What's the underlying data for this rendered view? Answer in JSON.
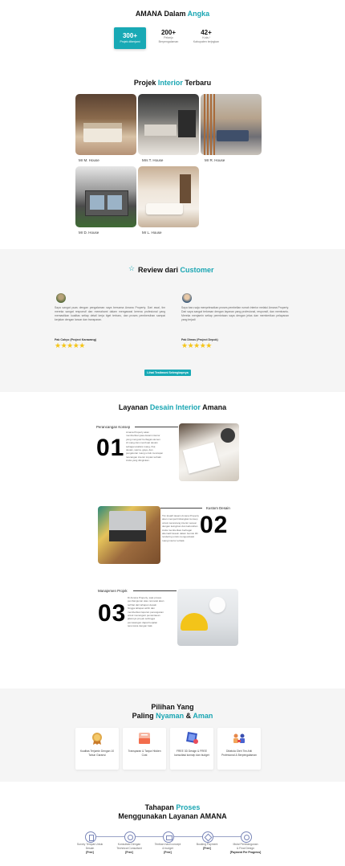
{
  "stats": {
    "title_prefix": "AMANA Dalam ",
    "title_accent": "Angka",
    "items": [
      {
        "num": "300+",
        "label": "Projek diberjami"
      },
      {
        "num": "200+",
        "label1": "Pelanjo",
        "label2": "Berpengalaman"
      },
      {
        "num": "42+",
        "label1": "Kota /",
        "label2": "Kabupaten terjngkan"
      }
    ]
  },
  "projects": {
    "title_prefix": "Projek ",
    "title_accent": "Interior",
    "title_suffix": " Terbaru",
    "items": [
      {
        "caption": "Mr M. House"
      },
      {
        "caption": "Mrs T. House"
      },
      {
        "caption": "Mr R. House"
      },
      {
        "caption": "Mr D. House"
      },
      {
        "caption": "Mr L. House"
      }
    ]
  },
  "reviews": {
    "title_prefix": "Review dari ",
    "title_accent": "Customer",
    "items": [
      {
        "text": "Saya sangat puas dengan pengalaman saya bersama Amana Property. Dari awal, tim mereka sangat responsif dan memahami dalam mengawasi kerena profesional yang memastikan kualitas setiap detail kerja tiget terbaru, dan proses pembersihan sampai kerjalan dengan lancar dan transparan.",
        "name": "Pak Cahyo (Project Karawang)",
        "stars": "★★★★★"
      },
      {
        "text": "Saya baru saja menyelesaikan proses pembelian rumah interior melalui Amana Property. Dari saya sangat terkesan dengan layanan yang profesional, responsif, dan membantu. Mereka menjamin setiap permintaan saya dengan jelas dan memberikan pelayanan yang terjadi",
        "name": "Pak Dimas (Project Depok)",
        "stars": "★★★★★"
      }
    ],
    "button": "Lihat Testimoni Selengkapnya"
  },
  "services": {
    "title_prefix": "Layanan ",
    "title_accent": "Desain Interior",
    "title_suffix": " Amana",
    "items": [
      {
        "title": "Perancangan Konsep",
        "num": "01",
        "desc": "Amana Property akan memberikan jasa desain interior yang mengusir berbagai elemen di ruang dan membuat desain sebagai analisis ruang, fitur, desain, warna, gaya, dan pengaturan ruang untuk mencapai rancangan interior impian terbaik Anda yang diinginkan."
      },
      {
        "title": "Kustom Desain",
        "num": "02",
        "desc": "Tim kreatif desain Amana Property akan mempertimbangkan konsep untuk merancang interior sesuai dengan keinginan dan kebutuhan Anda memberikan berbagai alternatif desain dalam bentuk 3D rendering untuk mengevaluasi ruang interior terbaik."
      },
      {
        "title": "Manajemen Projek",
        "num": "03",
        "desc": "Di Amana Property, saat proses pembangunan atau renovasi akan terlihat dari tahapan desain hingga tahapan akhir dan memberikan laporan penanganan untuk menangani pemantauan jalannya proyek sehingga pemasangan dapat berjalan terencana dengan baik."
      }
    ]
  },
  "why": {
    "title_line1": "Pilihan Yang",
    "title_line2_prefix": "Paling ",
    "title_accent1": "Nyaman",
    "title_mid": " & ",
    "title_accent2": "Aman",
    "items": [
      {
        "icon": "award-medal-icon",
        "text": "Kualitas Terjamin Dengan 10 Tahun Garansi"
      },
      {
        "icon": "document-price-icon",
        "text": "Transparan & Tanpa Hidden Cost"
      },
      {
        "icon": "design-3d-icon",
        "text": "FREE 3D Design & FREE konsultasi konsep dan budget"
      },
      {
        "icon": "team-icon",
        "text": "Dikelola Oleh Tim Ahli Profesional & Berpengalaman"
      }
    ]
  },
  "process": {
    "title_prefix": "Tahapan ",
    "title_accent": "Proses",
    "title_line2": "Menggunakan Layanan AMANA",
    "steps": [
      {
        "icon": "document-icon",
        "line1": "Survey Tempat Untuk",
        "line2": "Desain",
        "tag": "[Free]"
      },
      {
        "icon": "consult-icon",
        "line1": "Konsultasi Dengan",
        "line2": "Technical Consultant",
        "tag": "[Free]"
      },
      {
        "icon": "wallet-icon",
        "line1": "Tentkan hasil concept",
        "line2": "& budget",
        "tag": "[Free]"
      },
      {
        "icon": "payment-icon",
        "line1": "Booking Payment",
        "line2": "",
        "tag": "[Free]"
      },
      {
        "icon": "build-icon",
        "line1": "Mulai Pembangunan",
        "line2": "& Final Design",
        "tag": "[Payment Per Progress]"
      }
    ]
  }
}
